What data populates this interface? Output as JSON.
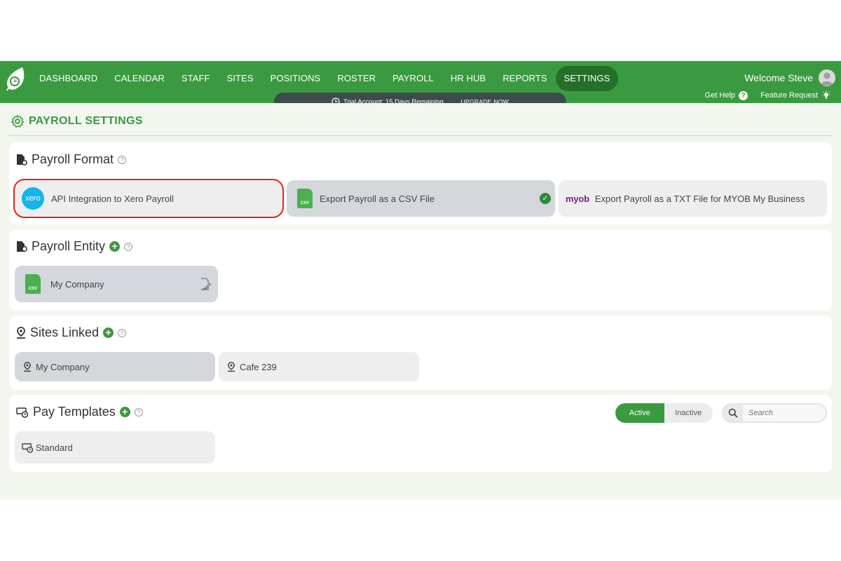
{
  "nav": {
    "items": [
      "DASHBOARD",
      "CALENDAR",
      "STAFF",
      "SITES",
      "POSITIONS",
      "ROSTER",
      "PAYROLL",
      "HR HUB",
      "REPORTS",
      "SETTINGS"
    ],
    "active_index": 9
  },
  "header": {
    "welcome": "Welcome Steve",
    "get_help": "Get Help",
    "feature_request": "Feature Request",
    "trial_text": "Trial Account: 15 Days Remaining.",
    "upgrade_label": "UPGRADE NOW"
  },
  "page": {
    "title": "PAYROLL SETTINGS"
  },
  "payroll_format": {
    "heading": "Payroll Format",
    "options": [
      {
        "logo": "xero",
        "label": "API Integration to Xero Payroll",
        "selected": false
      },
      {
        "logo": "CSV",
        "label": "Export Payroll as a CSV File",
        "selected": true
      },
      {
        "logo": "myob",
        "label": "Export Payroll as a TXT File for MYOB My Business",
        "selected": false
      }
    ]
  },
  "payroll_entity": {
    "heading": "Payroll Entity",
    "items": [
      {
        "label": "My Company",
        "icon_text": "CSV"
      }
    ]
  },
  "sites_linked": {
    "heading": "Sites Linked",
    "items": [
      {
        "label": "My Company"
      },
      {
        "label": "Cafe 239"
      }
    ]
  },
  "pay_templates": {
    "heading": "Pay Templates",
    "toggle": {
      "active": "Active",
      "inactive": "Inactive"
    },
    "search_placeholder": "Search",
    "items": [
      {
        "label": "Standard"
      }
    ]
  },
  "colors": {
    "brand_green": "#3a9a3f",
    "dark_green": "#24702a",
    "highlight_red": "#e02525"
  }
}
